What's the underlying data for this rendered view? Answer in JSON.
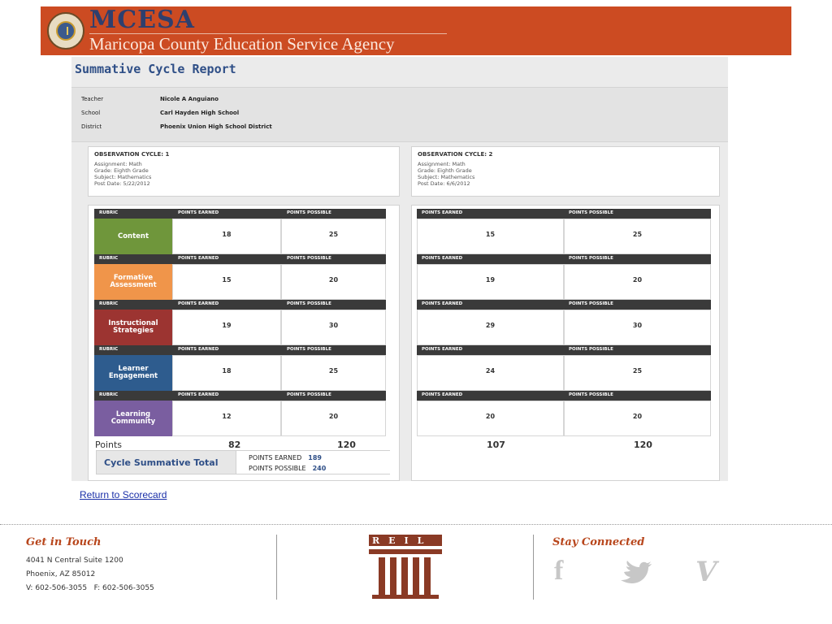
{
  "brand": {
    "acronym": "MCESA",
    "full_name": "Maricopa County Education Service Agency"
  },
  "report": {
    "title": "Summative Cycle Report",
    "info": [
      {
        "label": "Teacher",
        "value": "Nicole A Anguiano"
      },
      {
        "label": "School",
        "value": "Carl Hayden High School"
      },
      {
        "label": "District",
        "value": "Phoenix Union High School District"
      }
    ],
    "cycles": [
      {
        "heading": "OBSERVATION CYCLE: 1",
        "assignment": "Assignment: Math",
        "grade": "Grade: Eighth Grade",
        "subject": "Subject: Mathematics",
        "post_date": "Post Date: 5/22/2012"
      },
      {
        "heading": "OBSERVATION CYCLE: 2",
        "assignment": "Assignment: Math",
        "grade": "Grade: Eighth Grade",
        "subject": "Subject: Mathematics",
        "post_date": "Post Date: 6/6/2012"
      }
    ],
    "columns": {
      "rubric": "RUBRIC",
      "earned": "POINTS EARNED",
      "possible": "POINTS POSSIBLE"
    },
    "rubrics": [
      {
        "name": "Content",
        "color": "#6f963b",
        "c1_earned": "18",
        "c1_possible": "25",
        "c2_earned": "15",
        "c2_possible": "25"
      },
      {
        "name": "Formative Assessment",
        "color": "#f0954a",
        "c1_earned": "15",
        "c1_possible": "20",
        "c2_earned": "19",
        "c2_possible": "20"
      },
      {
        "name": "Instructional Strategies",
        "color": "#9c3431",
        "c1_earned": "19",
        "c1_possible": "30",
        "c2_earned": "29",
        "c2_possible": "30"
      },
      {
        "name": "Learner Engagement",
        "color": "#2e5c8e",
        "c1_earned": "18",
        "c1_possible": "25",
        "c2_earned": "24",
        "c2_possible": "25"
      },
      {
        "name": "Learning Community",
        "color": "#7a5ea0",
        "c1_earned": "12",
        "c1_possible": "20",
        "c2_earned": "20",
        "c2_possible": "20"
      }
    ],
    "points_label": "Points",
    "totals": {
      "c1_earned": "82",
      "c1_possible": "120",
      "c2_earned": "107",
      "c2_possible": "120"
    },
    "summative": {
      "title": "Cycle Summative Total",
      "earned_label": "POINTS EARNED",
      "earned_value": "189",
      "possible_label": "POINTS POSSIBLE",
      "possible_value": "240"
    }
  },
  "return_link": "Return to Scorecard",
  "footer": {
    "get_in_touch": "Get in Touch",
    "address1": "4041 N Central Suite 1200",
    "address2": "Phoenix, AZ 85012",
    "phone": "V: 602-506-3055   F: 602-506-3055",
    "reil_logo": "REIL",
    "stay_connected": "Stay Connected",
    "social": [
      "facebook-icon",
      "twitter-icon",
      "vimeo-icon"
    ]
  }
}
